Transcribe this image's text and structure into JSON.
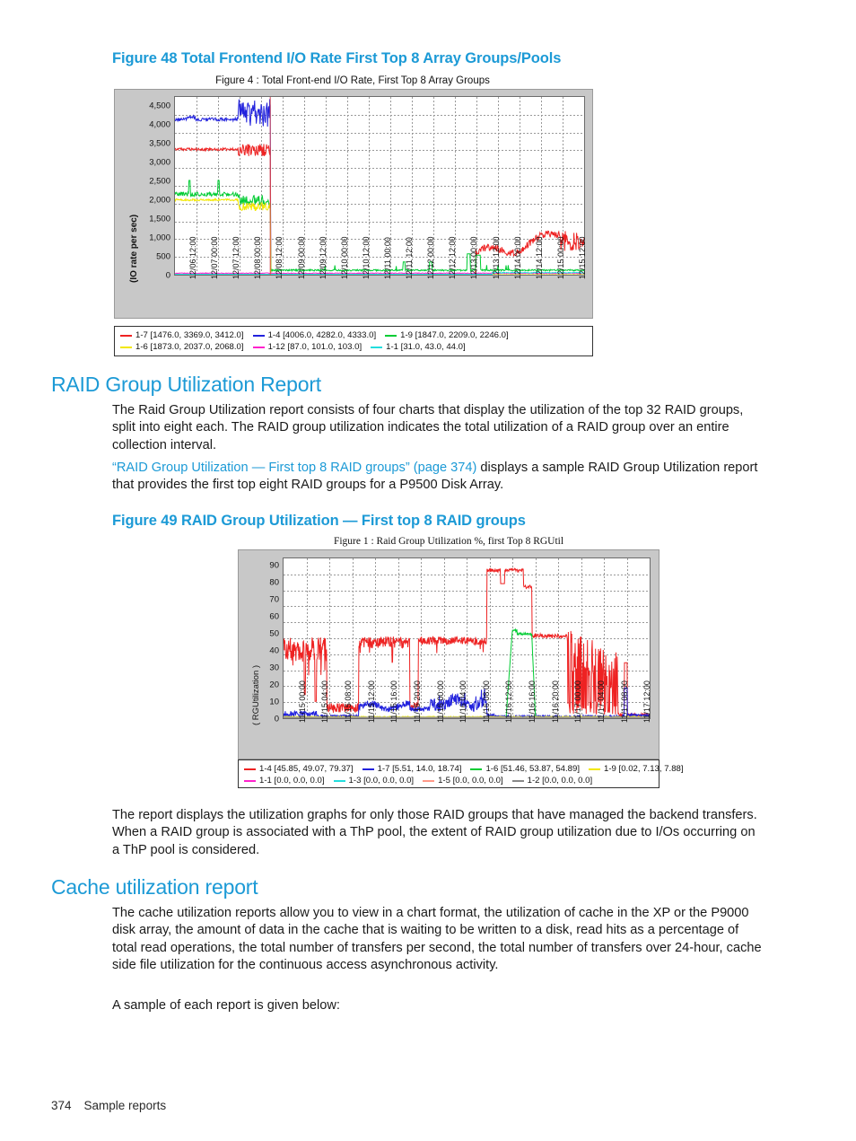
{
  "page": {
    "footer_page_number": "374",
    "footer_label": "Sample reports"
  },
  "figure48": {
    "caption": "Figure 48 Total Frontend I/O Rate First Top 8 Array Groups/Pools",
    "chart_title": "Figure 4 : Total Front-end I/O Rate, First Top 8 Array Groups"
  },
  "figure49": {
    "caption": "Figure 49 RAID Group Utilization — First top 8 RAID groups",
    "chart_title": "Figure 1 : Raid Group Utilization %, first Top 8 RGUtil"
  },
  "sections": {
    "raid_heading": "RAID Group Utilization Report",
    "raid_para1": "The Raid Group Utilization report consists of four charts that display the utilization of the top 32 RAID groups, split into eight each. The RAID group utilization indicates the total utilization of a RAID group over an entire collection interval.",
    "raid_para2_link": "“RAID Group Utilization — First top 8 RAID groups” (page 374)",
    "raid_para2_rest": " displays a sample RAID Group Utilization report that provides the first top eight RAID groups for a P9500 Disk Array.",
    "raid_para3": "The report displays the utilization graphs for only those RAID groups that have managed the backend transfers. When a RAID group is associated with a ThP pool, the extent of RAID group utilization due to I/Os occurring on a ThP pool is considered.",
    "cache_heading": "Cache utilization report",
    "cache_para1": "The cache utilization reports allow you to view in a chart format, the utilization of cache in the XP or the P9000 disk array, the amount of data in the cache that is waiting to be written to a disk, read hits as a percentage of total read operations, the total number of transfers per second, the total number of transfers over 24-hour, cache side file utilization for the continuous access asynchronous activity.",
    "cache_para2": "A sample of each report is given below:"
  },
  "chart_data": [
    {
      "id": "frontend-io-rate",
      "type": "line",
      "title": "Figure 4 : Total Front-end I/O Rate, First Top 8 Array Groups",
      "xlabel": "",
      "ylabel": "(IO rate per sec)",
      "ylim": [
        0,
        4750
      ],
      "yticks": [
        0,
        500,
        1000,
        1500,
        2000,
        2500,
        3000,
        3500,
        4000,
        4500
      ],
      "ytick_labels": [
        "0",
        "500",
        "1,000",
        "1,500",
        "2,000",
        "2,500",
        "3,000",
        "3,500",
        "4,000",
        "4,500"
      ],
      "grid": true,
      "legend_position": "below",
      "xtick_labels": [
        "12/06 12:00",
        "12/07 00:00",
        "12/07 12:00",
        "12/08 00:00",
        "12/08 12:00",
        "12/09 00:00",
        "12/09 12:00",
        "12/10 00:00",
        "12/10 12:00",
        "12/11 00:00",
        "12/11 12:00",
        "12/12 00:00",
        "12/12 12:00",
        "12/13 00:00",
        "12/13 12:00",
        "12/14 00:00",
        "12/14 12:00",
        "12/15 00:00",
        "12/15 12:00"
      ],
      "series": [
        {
          "name": "1-7",
          "color": "#ee2222",
          "stats": [
            1476.0,
            3369.0,
            3412.0
          ],
          "legend": "1-7 [1476.0, 3369.0, 3412.0]"
        },
        {
          "name": "1-4",
          "color": "#2222dd",
          "stats": [
            4006.0,
            4282.0,
            4333.0
          ],
          "legend": "1-4 [4006.0, 4282.0, 4333.0]"
        },
        {
          "name": "1-9",
          "color": "#00cc33",
          "stats": [
            1847.0,
            2209.0,
            2246.0
          ],
          "legend": "1-9 [1847.0, 2209.0, 2246.0]"
        },
        {
          "name": "1-6",
          "color": "#f2e800",
          "stats": [
            1873.0,
            2037.0,
            2068.0
          ],
          "legend": "1-6 [1873.0, 2037.0, 2068.0]"
        },
        {
          "name": "1-12",
          "color": "#ff22cc",
          "stats": [
            87.0,
            101.0,
            103.0
          ],
          "legend": "1-12 [87.0, 101.0, 103.0]"
        },
        {
          "name": "1-1",
          "color": "#22dddd",
          "stats": [
            31.0,
            43.0,
            44.0
          ],
          "legend": "1-1 [31.0, 43.0, 44.0]"
        }
      ]
    },
    {
      "id": "raid-group-utilization",
      "type": "line",
      "title": "Figure 1 : Raid Group Utilization %, first Top 8 RGUtil",
      "xlabel": "",
      "ylabel": "( RGUtilization )",
      "ylim": [
        0,
        95
      ],
      "yticks": [
        0,
        10,
        20,
        30,
        40,
        50,
        60,
        70,
        80,
        90
      ],
      "ytick_labels": [
        "0",
        "10",
        "20",
        "30",
        "40",
        "50",
        "60",
        "70",
        "80",
        "90"
      ],
      "grid": true,
      "legend_position": "below",
      "xtick_labels": [
        "11/15 00:00",
        "11/15 04:00",
        "11/15 08:00",
        "11/15 12:00",
        "11/15 16:00",
        "11/15 20:00",
        "11/16 00:00",
        "11/16 04:00",
        "11/16 08:00",
        "11/16 12:00",
        "11/16 16:00",
        "11/16 20:00",
        "11/17 00:00",
        "11/17 04:00",
        "11/17 08:00",
        "11/17 12:00"
      ],
      "series": [
        {
          "name": "1-4",
          "color": "#ee2222",
          "stats": [
            45.85,
            49.07,
            79.37
          ],
          "legend": "1-4 [45.85, 49.07, 79.37]"
        },
        {
          "name": "1-7",
          "color": "#2222dd",
          "stats": [
            5.51,
            14.0,
            18.74
          ],
          "legend": "1-7 [5.51, 14.0, 18.74]"
        },
        {
          "name": "1-6",
          "color": "#00cc33",
          "stats": [
            51.46,
            53.87,
            54.89
          ],
          "legend": "1-6 [51.46, 53.87, 54.89]"
        },
        {
          "name": "1-9",
          "color": "#f2e800",
          "stats": [
            0.02,
            7.13,
            7.88
          ],
          "legend": "1-9 [0.02, 7.13, 7.88]"
        },
        {
          "name": "1-1",
          "color": "#ff22cc",
          "stats": [
            0.0,
            0.0,
            0.0
          ],
          "legend": "1-1 [0.0, 0.0, 0.0]"
        },
        {
          "name": "1-3",
          "color": "#22dddd",
          "stats": [
            0.0,
            0.0,
            0.0
          ],
          "legend": "1-3 [0.0, 0.0, 0.0]"
        },
        {
          "name": "1-5",
          "color": "#ff9988",
          "stats": [
            0.0,
            0.0,
            0.0
          ],
          "legend": "1-5 [0.0, 0.0, 0.0]"
        },
        {
          "name": "1-2",
          "color": "#888888",
          "stats": [
            0.0,
            0.0,
            0.0
          ],
          "legend": "1-2 [0.0, 0.0, 0.0]"
        }
      ]
    }
  ]
}
